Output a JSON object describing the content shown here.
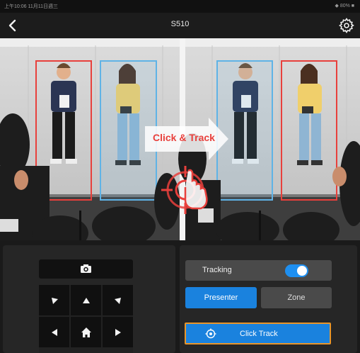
{
  "status_bar": {
    "left_text": "上午10:06 11月11日週三",
    "right_text": "◆ 80% ■"
  },
  "header": {
    "title": "S510",
    "back_icon": "chevron-left-icon",
    "settings_icon": "gear-icon"
  },
  "preview": {
    "overlay_label": "Click & Track",
    "colors": {
      "selected_box": "#e8403c",
      "candidate_box": "#5fb3e6"
    }
  },
  "camera_controls": {
    "snapshot_icon": "camera-icon",
    "dpad": [
      "up-left",
      "up",
      "up-right",
      "left",
      "home",
      "right"
    ]
  },
  "tracking": {
    "label": "Tracking",
    "enabled": true,
    "mode_presenter": "Presenter",
    "mode_zone": "Zone",
    "selected_mode": "Presenter",
    "click_track_label": "Click Track"
  },
  "colors": {
    "accent": "#1a82de",
    "highlight_border": "#e8952a",
    "panel": "#262626"
  }
}
